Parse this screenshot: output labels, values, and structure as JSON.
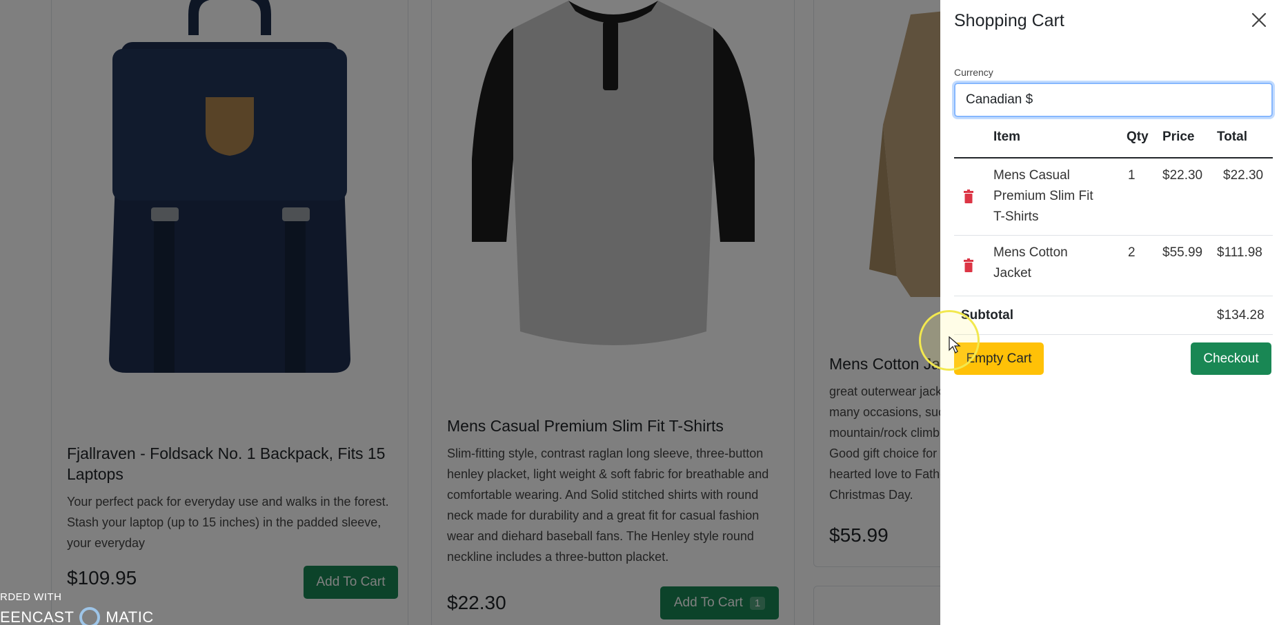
{
  "products": [
    {
      "title": "Fjallraven - Foldsack No. 1 Backpack, Fits 15 Laptops",
      "description": "Your perfect pack for everyday use and walks in the forest. Stash your laptop (up to 15 inches) in the padded sleeve, your everyday",
      "price": "$109.95",
      "button_label": "Add To Cart"
    },
    {
      "title": "Mens Casual Premium Slim Fit T-Shirts",
      "description": "Slim-fitting style, contrast raglan long sleeve, three-button henley placket, light weight & soft fabric for breathable and comfortable wearing. And Solid stitched shirts with round neck made for durability and a great fit for casual fashion wear and diehard baseball fans. The Henley style round neckline includes a three-button placket.",
      "price": "$22.30",
      "button_label": "Add To Cart",
      "cart_qty": "1"
    },
    {
      "title": "Mens Cotton Jacket",
      "description": "great outerwear jackets for Spring/Autumn/Winter, suitable for many occasions, such as working, hiking, camping, mountain/rock climbing, cycling, traveling or other outdoors. Good gift choice for you or your family member. A warm hearted love to Father, husband or son in this thanksgiving or Christmas Day.",
      "price": "$55.99"
    }
  ],
  "watermark": {
    "line1": "RDED WITH",
    "line2a": "EENCAST",
    "line2b": "MATIC"
  },
  "cart": {
    "title": "Shopping Cart",
    "currency_label": "Currency",
    "currency_value": "Canadian $",
    "columns": [
      "Item",
      "Qty",
      "Price",
      "Total"
    ],
    "items": [
      {
        "name": "Mens Casual Premium Slim Fit T-Shirts",
        "name_lines": [
          "Mens Casual",
          "Premium Slim Fit",
          "T-Shirts"
        ],
        "qty": "1",
        "price": "$22.30",
        "total": "$22.30"
      },
      {
        "name": "Mens Cotton Jacket",
        "name_lines": [
          "Mens Cotton",
          "Jacket"
        ],
        "qty": "2",
        "price": "$55.99",
        "total": "$111.98"
      }
    ],
    "subtotal_label": "Subtotal",
    "subtotal_value": "$134.28",
    "empty_label": "Empty Cart",
    "checkout_label": "Checkout"
  },
  "colors": {
    "primary_green": "#198754",
    "warning_yellow": "#ffc107",
    "danger_red": "#dc3545"
  }
}
